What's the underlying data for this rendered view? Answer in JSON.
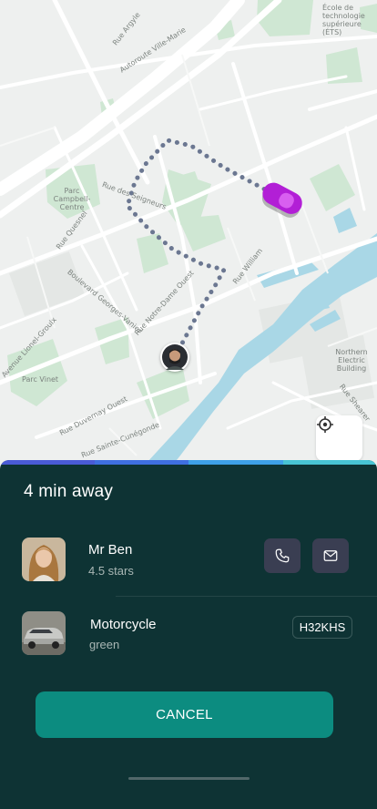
{
  "map": {
    "labels": [
      "École de technologie supérieure (ÉTS)",
      "Rue Argyle",
      "Autoroute Ville-Marie",
      "Parc Campbell-Centre",
      "Rue des Seigneurs",
      "Rue Quesnel",
      "Boulevard Georges-Vanier",
      "Rue Notre-Dame Ouest",
      "Rue William",
      "Avenue Lionel-Groulx",
      "Parc Vinet",
      "Rue Duvernay Ouest",
      "Rue Sainte-Cunégonde",
      "Northern Electric Building",
      "Rue Shearer"
    ],
    "locate_icon": "crosshair-icon"
  },
  "ride": {
    "eta": "4 min away",
    "progress_colors": [
      "#4a5bd6",
      "#3f6fe0",
      "#3ea0e8",
      "#48c4d4"
    ],
    "driver": {
      "name": "Mr Ben",
      "rating": "4.5 stars"
    },
    "vehicle": {
      "type": "Motorcycle",
      "color": "green",
      "plate": "H32KHS"
    },
    "cancel_label": "CANCEL"
  },
  "colors": {
    "sheet": "#0e3334",
    "accent": "#0c8c80",
    "car": "#b21fd6"
  }
}
